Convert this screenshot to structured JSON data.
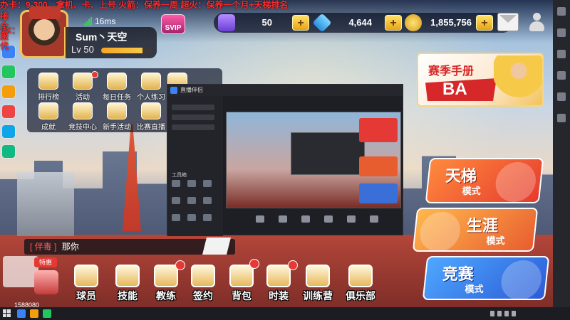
{
  "overlay": {
    "line1": "办卡：9-300，拿机、卡、上号  火箭：保养一周  超火：保养一个月+天梯排名",
    "line2": "接全服代",
    "line3": "VX：",
    "color": "#ff2a2a"
  },
  "player": {
    "name": "Sum丶天空",
    "level_label": "Lv 50",
    "exp_fraction": 0.8,
    "ping": "16ms",
    "vip_badge": "SVIP"
  },
  "currency": {
    "tickets": "50",
    "diamonds": "4,644",
    "gold": "1,855,756",
    "plus_label": "+"
  },
  "function_grid": [
    {
      "id": "rankings",
      "label": "排行榜",
      "icon": "trophy-icon",
      "dot": false
    },
    {
      "id": "events",
      "label": "活动",
      "icon": "event-icon",
      "dot": true
    },
    {
      "id": "daily",
      "label": "每日任务",
      "icon": "checklist-icon",
      "dot": false
    },
    {
      "id": "practice",
      "label": "个人练习",
      "icon": "basketball-icon",
      "dot": false
    },
    {
      "id": "battle",
      "label": "战",
      "icon": "battle-icon",
      "dot": false
    },
    {
      "id": "achievements",
      "label": "成就",
      "icon": "medal-icon",
      "dot": false
    },
    {
      "id": "arena",
      "label": "竞技中心",
      "icon": "arena-icon",
      "dot": false
    },
    {
      "id": "newbie",
      "label": "新手活动",
      "icon": "star-icon",
      "dot": false
    },
    {
      "id": "live",
      "label": "比赛直播",
      "icon": "live-icon",
      "dot": false
    }
  ],
  "season": {
    "title": "赛季手册",
    "banner": "BA"
  },
  "modes": {
    "ladder": {
      "title": "天梯",
      "sub": "模式"
    },
    "career": {
      "title": "生涯",
      "sub": "模式"
    },
    "compete": {
      "title": "竞赛",
      "sub": "模式"
    }
  },
  "chat": {
    "channel": "[ 伴毒 ]",
    "text": "那你"
  },
  "special_offer": {
    "badge": "特惠"
  },
  "bottom_nav": [
    {
      "id": "players",
      "label": "球员",
      "icon": "jersey-icon",
      "dot": false
    },
    {
      "id": "skills",
      "label": "技能",
      "icon": "skill-icon",
      "dot": false
    },
    {
      "id": "coach",
      "label": "教练",
      "icon": "coach-icon",
      "dot": true
    },
    {
      "id": "contract",
      "label": "签约",
      "icon": "contract-icon",
      "dot": false
    },
    {
      "id": "bag",
      "label": "背包",
      "icon": "bag-icon",
      "dot": true
    },
    {
      "id": "fashion",
      "label": "时装",
      "icon": "shirt-icon",
      "dot": true
    },
    {
      "id": "training",
      "label": "训练营",
      "icon": "training-icon",
      "dot": false
    },
    {
      "id": "club",
      "label": "俱乐部",
      "icon": "club-icon",
      "dot": false
    }
  ],
  "client": {
    "title": "直播伴侣",
    "tools_label": "工具箱"
  },
  "watermark": {
    "number": "1588080"
  }
}
